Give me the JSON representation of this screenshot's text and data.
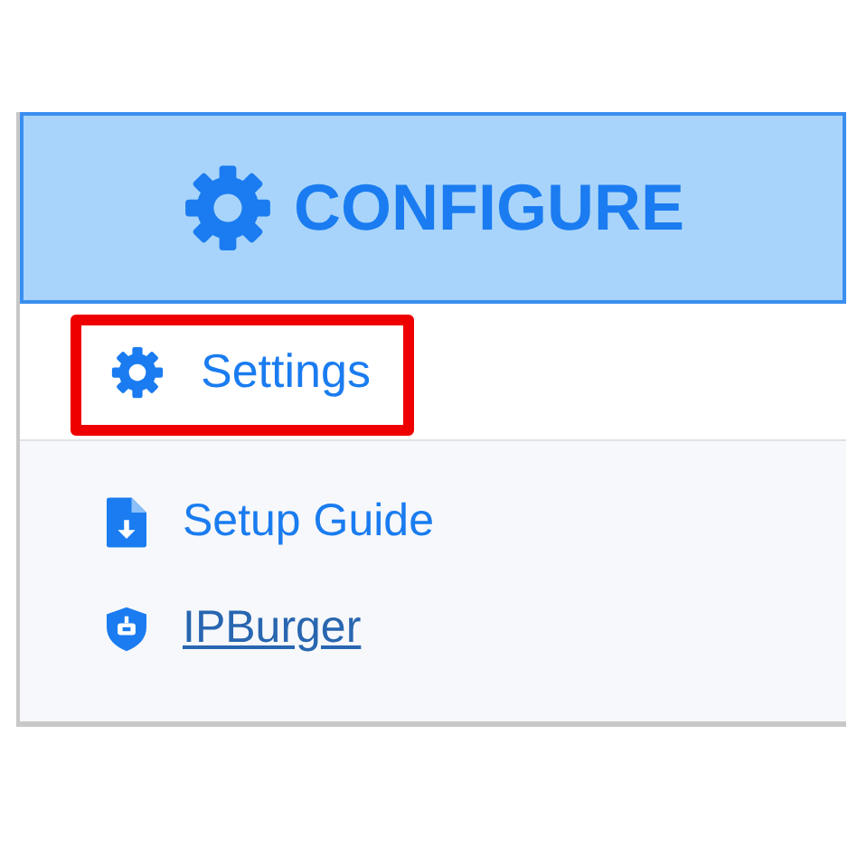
{
  "header": {
    "title": "CONFIGURE"
  },
  "settings_item": {
    "label": "Settings",
    "highlighted": true
  },
  "links": [
    {
      "label": "Setup Guide",
      "kind": "guide"
    },
    {
      "label": "IPBurger",
      "kind": "link"
    }
  ]
}
